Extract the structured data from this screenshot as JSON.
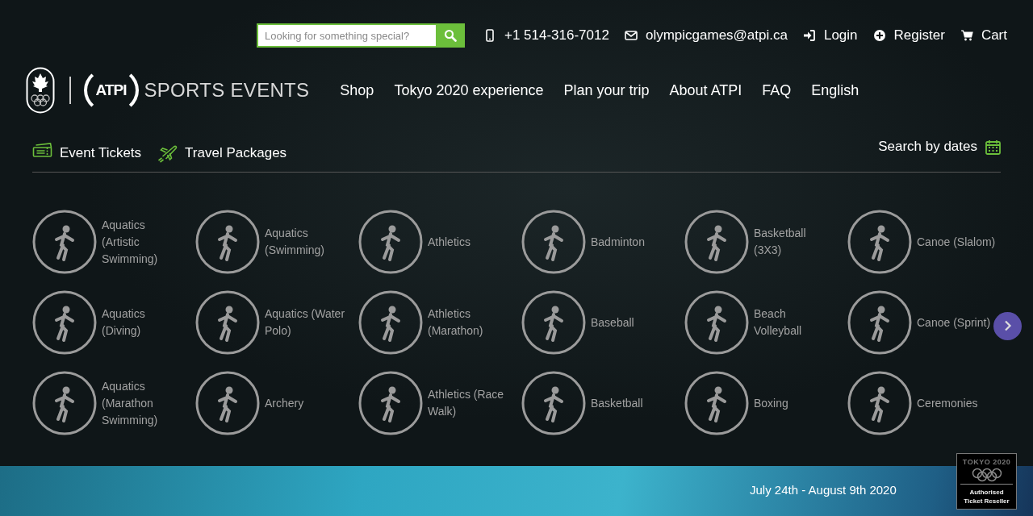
{
  "search": {
    "placeholder": "Looking for something special?"
  },
  "contacts": [
    {
      "kind": "phone",
      "text": "+1 514-316-7012"
    },
    {
      "kind": "email",
      "text": "olympicgames@atpi.ca"
    },
    {
      "kind": "login",
      "text": "Login"
    },
    {
      "kind": "register",
      "text": "Register"
    },
    {
      "kind": "cart",
      "text": "Cart"
    }
  ],
  "logo": {
    "mark": "ATPI",
    "name": "SPORTS EVENTS"
  },
  "nav": [
    "Shop",
    "Tokyo 2020 experience",
    "Plan your trip",
    "About ATPI",
    "FAQ",
    "English"
  ],
  "tabs": [
    {
      "kind": "tickets",
      "label": "Event Tickets"
    },
    {
      "kind": "travel",
      "label": "Travel Packages"
    }
  ],
  "date_search": "Search by dates",
  "sports": [
    "Aquatics (Artistic Swimming)",
    "Aquatics (Swimming)",
    "Athletics",
    "Badminton",
    "Basketball (3X3)",
    "Canoe (Slalom)",
    "Aquatics (Diving)",
    "Aquatics (Water Polo)",
    "Athletics (Marathon)",
    "Baseball",
    "Beach Volleyball",
    "Canoe (Sprint)",
    "Aquatics (Marathon Swimming)",
    "Archery",
    "Athletics (Race Walk)",
    "Basketball",
    "Boxing",
    "Ceremonies"
  ],
  "footer": {
    "dates": "July 24th - August 9th 2020",
    "badge": {
      "title": "TOKYO 2020",
      "caption": "Authorised Ticket Reseller"
    }
  }
}
